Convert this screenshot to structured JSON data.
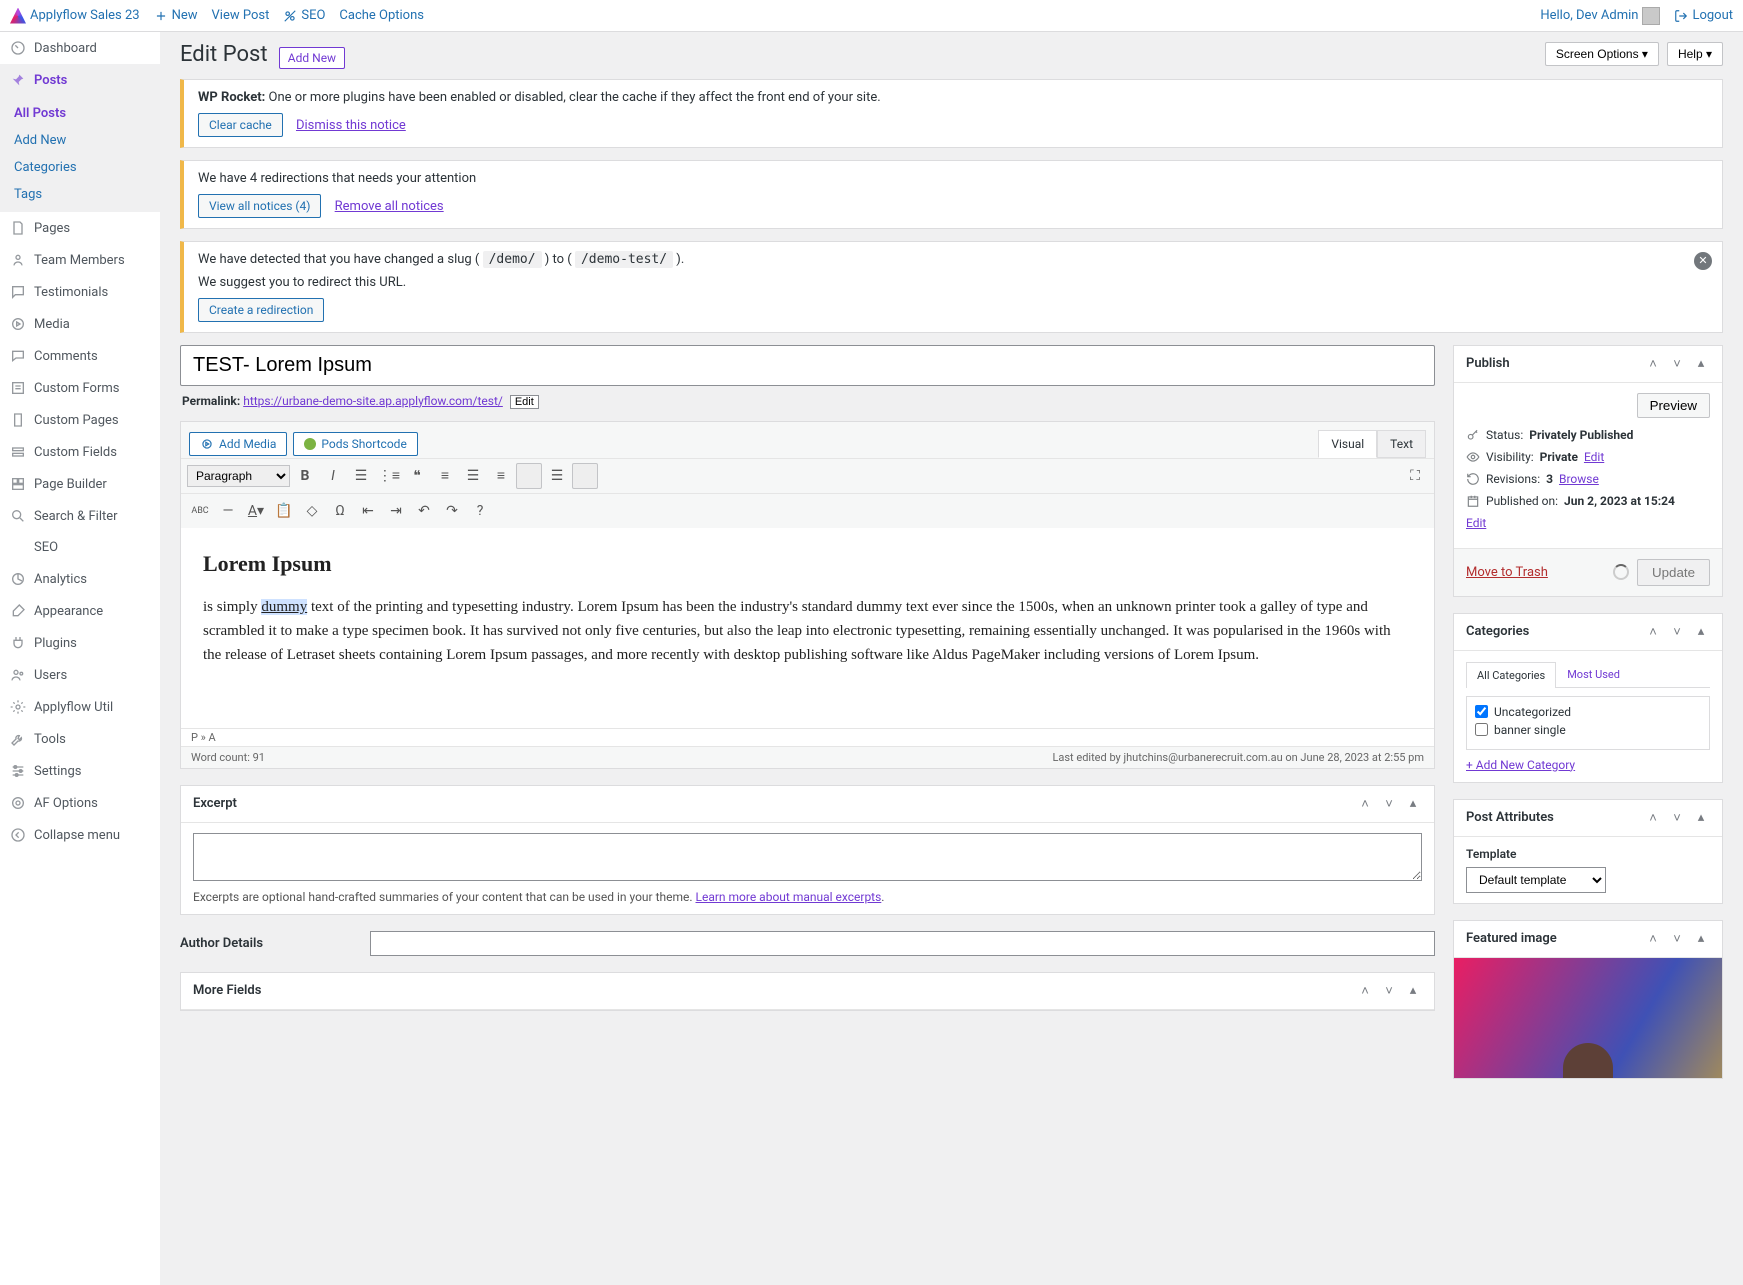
{
  "topbar": {
    "site_name": "Applyflow Sales 23",
    "new": "New",
    "view_post": "View Post",
    "seo": "SEO",
    "cache": "Cache Options",
    "greeting": "Hello, Dev Admin",
    "logout": "Logout"
  },
  "sidebar": {
    "items": [
      {
        "label": "Dashboard"
      },
      {
        "label": "Posts",
        "active": true,
        "subs": [
          {
            "label": "All Posts",
            "current": true
          },
          {
            "label": "Add New"
          },
          {
            "label": "Categories"
          },
          {
            "label": "Tags"
          }
        ]
      },
      {
        "label": "Pages"
      },
      {
        "label": "Team Members"
      },
      {
        "label": "Testimonials"
      },
      {
        "label": "Media"
      },
      {
        "label": "Comments"
      },
      {
        "label": "Custom Forms"
      },
      {
        "label": "Custom Pages"
      },
      {
        "label": "Custom Fields"
      },
      {
        "label": "Page Builder"
      },
      {
        "label": "Search & Filter"
      },
      {
        "label": "SEO",
        "indent": true
      },
      {
        "label": "Analytics"
      },
      {
        "label": "Appearance"
      },
      {
        "label": "Plugins"
      },
      {
        "label": "Users"
      },
      {
        "label": "Applyflow Util"
      },
      {
        "label": "Tools"
      },
      {
        "label": "Settings"
      },
      {
        "label": "AF Options"
      },
      {
        "label": "Collapse menu"
      }
    ]
  },
  "header": {
    "title": "Edit Post",
    "add_new": "Add New",
    "screen_options": "Screen Options ▾",
    "help": "Help ▾"
  },
  "notices": {
    "rocket_prefix": "WP Rocket:",
    "rocket_msg": " One or more plugins have been enabled or disabled, clear the cache if they affect the front end of your site.",
    "clear_cache": "Clear cache",
    "dismiss": "Dismiss this notice",
    "redir_msg": "We have 4 redirections that needs your attention",
    "view_notices": "View all notices (4)",
    "remove_notices": "Remove all notices",
    "slug_pre": "We have detected that you have changed a slug ( ",
    "slug_old": "/demo/",
    "slug_mid": " ) to ( ",
    "slug_new": "/demo-test/",
    "slug_post": " ).",
    "slug_suggest": "We suggest you to redirect this URL.",
    "create_redir": "Create a redirection"
  },
  "post": {
    "title": "TEST- Lorem Ipsum",
    "permalink_label": "Permalink:",
    "permalink_url": "https://urbane-demo-site.ap.applyflow.com/test/",
    "edit": "Edit"
  },
  "editor": {
    "add_media": "Add Media",
    "pods": "Pods Shortcode",
    "tab_visual": "Visual",
    "tab_text": "Text",
    "format_sel": "Paragraph",
    "heading": "Lorem Ipsum",
    "body_pre": "is simply ",
    "body_hl": "dummy",
    "body_post": " text of the printing and typesetting industry. Lorem Ipsum has been the industry's standard dummy text ever since the 1500s, when an unknown printer took a galley of type and scrambled it to make a type specimen book. It has survived not only five centuries, but also the leap into electronic typesetting, remaining essentially unchanged. It was popularised in the 1960s with the release of Letraset sheets containing Lorem Ipsum passages, and more recently with desktop publishing software like Aldus PageMaker including versions of Lorem Ipsum.",
    "path": "P » A",
    "wordcount": "Word count: 91",
    "last_edit": "Last edited by jhutchins@urbanerecruit.com.au on June 28, 2023 at 2:55 pm"
  },
  "excerpt": {
    "title": "Excerpt",
    "help_pre": "Excerpts are optional hand-crafted summaries of your content that can be used in your theme. ",
    "help_link": "Learn more about manual excerpts",
    "help_post": "."
  },
  "author": {
    "label": "Author Details"
  },
  "morefields": {
    "title": "More Fields"
  },
  "publish": {
    "title": "Publish",
    "preview": "Preview",
    "status_label": "Status:",
    "status_val": "Privately Published",
    "visibility_label": "Visibility:",
    "visibility_val": "Private",
    "edit": "Edit",
    "revisions_label": "Revisions:",
    "revisions_val": "3",
    "browse": "Browse",
    "published_label": "Published on:",
    "published_val": "Jun 2, 2023 at 15:24",
    "trash": "Move to Trash",
    "update": "Update"
  },
  "categories": {
    "title": "Categories",
    "tab_all": "All Categories",
    "tab_used": "Most Used",
    "items": [
      {
        "label": "Uncategorized",
        "checked": true
      },
      {
        "label": "banner single",
        "checked": false
      }
    ],
    "add": "+ Add New Category"
  },
  "attrs": {
    "title": "Post Attributes",
    "template_label": "Template",
    "template_val": "Default template"
  },
  "featured": {
    "title": "Featured image"
  }
}
